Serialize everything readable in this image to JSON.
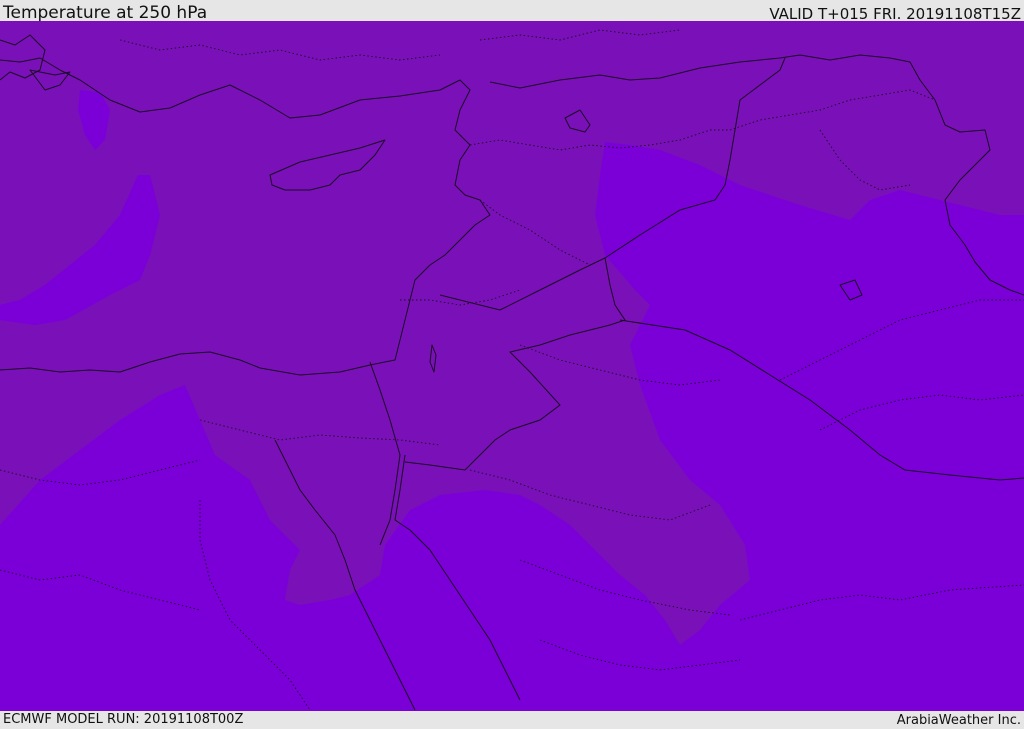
{
  "header": {
    "title": "Temperature at 250 hPa",
    "valid": "VALID T+015 FRI. 20191108T15Z"
  },
  "footer": {
    "model_run": "ECMWF MODEL RUN: 20191108T00Z",
    "credit": "ArabiaWeather Inc."
  },
  "colors": {
    "band_warm": "#7a10b8",
    "band_cool": "#7b00d8",
    "lines": "#1b0b25",
    "bar_background": "#e6e6e6"
  }
}
